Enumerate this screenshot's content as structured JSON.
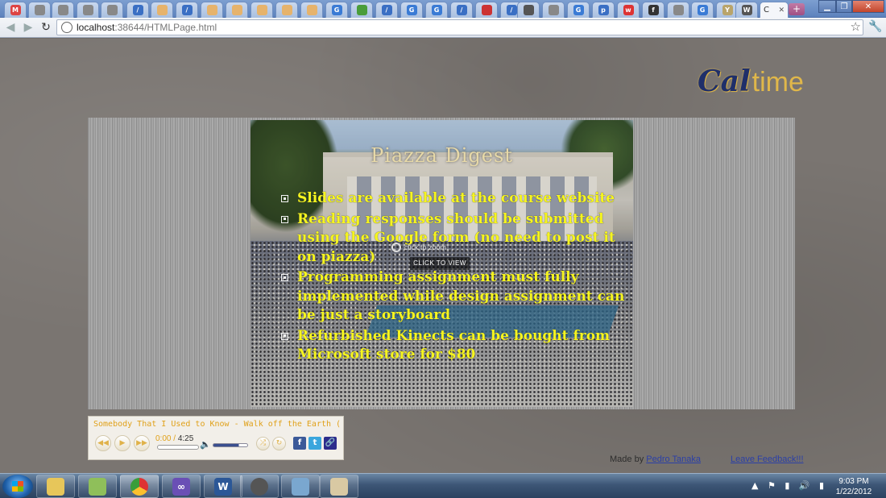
{
  "browser": {
    "url_host": "localhost",
    "url_rest": ":38644/HTMLPage.html",
    "active_tab_short": "C"
  },
  "tabs": [
    {
      "icon": "gmail-icon",
      "glyph": "M",
      "color": "#d44"
    },
    {
      "icon": "globe-icon",
      "glyph": "",
      "color": "#888"
    },
    {
      "icon": "globe-icon",
      "glyph": "",
      "color": "#888"
    },
    {
      "icon": "globe-icon",
      "glyph": "",
      "color": "#888"
    },
    {
      "icon": "globe-icon",
      "glyph": "",
      "color": "#888"
    },
    {
      "icon": "pen-icon",
      "glyph": "/",
      "color": "#3a6fc4"
    },
    {
      "icon": "cake-icon",
      "glyph": "",
      "color": "#e6b36c"
    },
    {
      "icon": "pen-icon",
      "glyph": "/",
      "color": "#3a6fc4"
    },
    {
      "icon": "cake-icon",
      "glyph": "",
      "color": "#e6b36c"
    },
    {
      "icon": "cake-icon",
      "glyph": "",
      "color": "#e6b36c"
    },
    {
      "icon": "cake-icon",
      "glyph": "",
      "color": "#e6b36c"
    },
    {
      "icon": "cake-icon",
      "glyph": "",
      "color": "#e6b36c"
    },
    {
      "icon": "cake-icon",
      "glyph": "",
      "color": "#e6b36c"
    },
    {
      "icon": "google-icon",
      "glyph": "G",
      "color": "#3a7bd5"
    },
    {
      "icon": "chrome-icon",
      "glyph": "",
      "color": "#4a9d3a"
    },
    {
      "icon": "pen-icon",
      "glyph": "/",
      "color": "#3a6fc4"
    },
    {
      "icon": "google-icon",
      "glyph": "G",
      "color": "#3a7bd5"
    },
    {
      "icon": "google-icon",
      "glyph": "G",
      "color": "#3a7bd5"
    },
    {
      "icon": "pen-icon",
      "glyph": "/",
      "color": "#3a6fc4"
    },
    {
      "icon": "red-app-icon",
      "glyph": "",
      "color": "#c33"
    },
    {
      "icon": "pen-icon",
      "glyph": "/",
      "color": "#3a6fc4"
    },
    {
      "icon": "doc-icon",
      "glyph": "",
      "color": "#555"
    },
    {
      "icon": "globe-icon",
      "glyph": "",
      "color": "#888"
    },
    {
      "icon": "google-icon",
      "glyph": "G",
      "color": "#3a7bd5"
    },
    {
      "icon": "piazza-icon",
      "glyph": "p",
      "color": "#3a6fc4"
    },
    {
      "icon": "wikia-icon",
      "glyph": "w",
      "color": "#d33"
    },
    {
      "icon": "facebook-icon",
      "glyph": "f",
      "color": "#333"
    },
    {
      "icon": "globe-icon",
      "glyph": "",
      "color": "#888"
    },
    {
      "icon": "google-icon",
      "glyph": "G",
      "color": "#3a7bd5"
    },
    {
      "icon": "y-icon",
      "glyph": "Y",
      "color": "#b9a46a"
    },
    {
      "icon": "wikipedia-icon",
      "glyph": "W",
      "color": "#555"
    }
  ],
  "logo": {
    "cal": "Cal",
    "time": "time"
  },
  "slide": {
    "title": "Piazza Digest",
    "bullets": [
      "Slides are available at the course website",
      "Reading responses should be submitted using the Google form (no need to post it on piazza)",
      "Programming assignment must fully implemented while design assignment can be just a storyboard",
      "Refurbished Kinects can be bought from Microsoft store for $80"
    ],
    "zoom_text": "click to zoom",
    "click_to_view": "CLICK TO VIEW"
  },
  "player": {
    "track": "Somebody That I Used to Know - Walk off the Earth (Go...",
    "current": "0:00",
    "total": "4:25",
    "volume_fraction": 0.75
  },
  "footer": {
    "made_by": "Made by",
    "author": "Pedro Tanaka",
    "feedback": "Leave Feedback!!!"
  },
  "clock": {
    "time": "9:03 PM",
    "date": "1/22/2012"
  },
  "colors": {
    "slide_text": "#f6f51f",
    "link": "#2b3fa6",
    "accent": "#e0a11a"
  }
}
